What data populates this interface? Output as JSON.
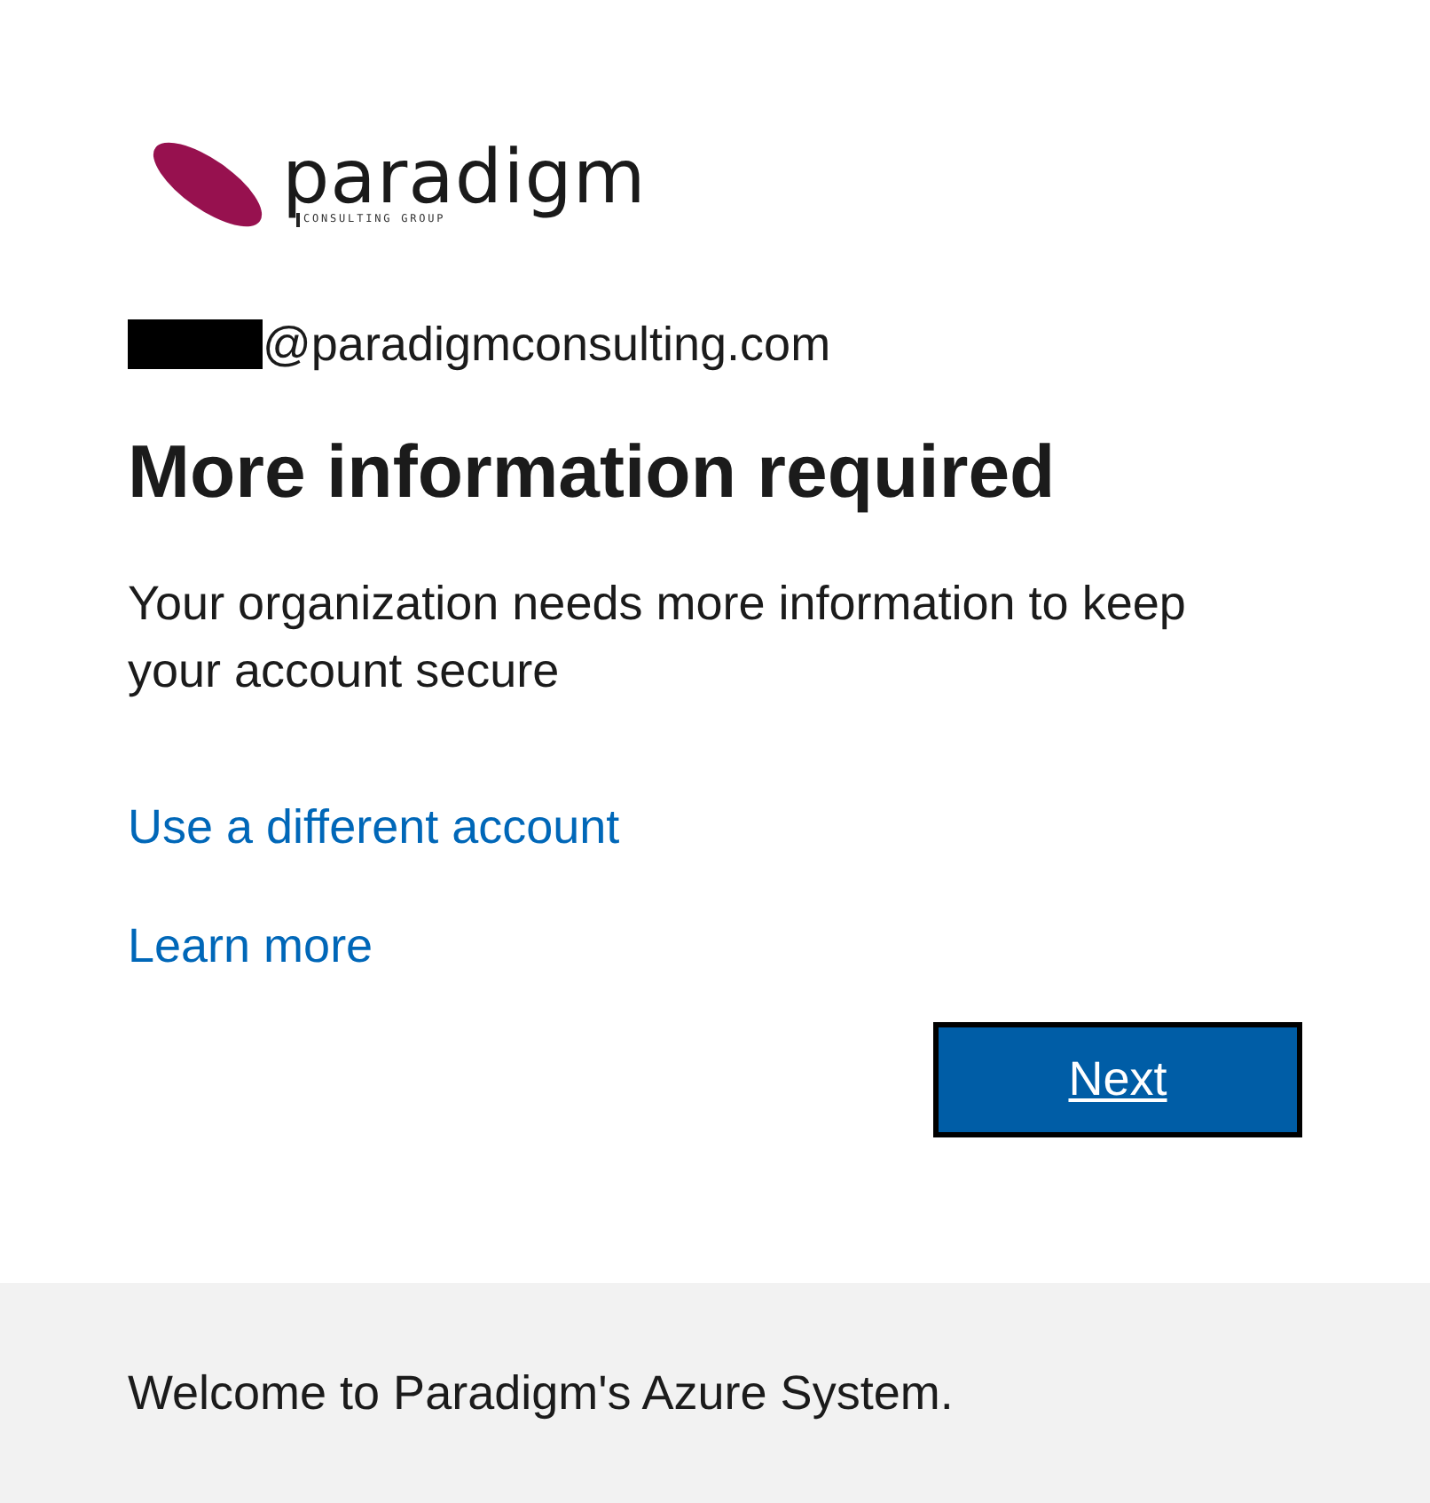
{
  "logo": {
    "name": "paradigm",
    "tagline": "CONSULTING GROUP"
  },
  "account": {
    "redacted": true,
    "email": "@paradigmconsulting.com"
  },
  "title": "More information required",
  "description": "Your organization needs more information to keep your account secure",
  "links": [
    "Use a different account",
    "Learn more"
  ],
  "next_button": {
    "label": "Next",
    "focused": true
  },
  "footer": {
    "text": "Welcome to Paradigm's Azure System."
  }
}
